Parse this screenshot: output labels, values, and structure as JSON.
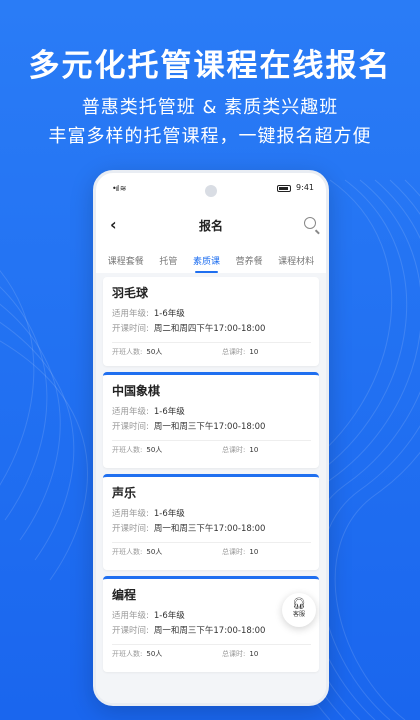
{
  "headline": "多元化托管课程在线报名",
  "subline1": "普惠类托管班 & 素质类兴趣班",
  "subline2": "丰富多样的托管课程，一键报名超方便",
  "status": {
    "time": "9:41",
    "signal": "•ıl ≋"
  },
  "nav": {
    "back": "‹",
    "title": "报名"
  },
  "tabs": [
    {
      "label": "课程套餐",
      "active": false
    },
    {
      "label": "托管",
      "active": false
    },
    {
      "label": "素质课",
      "active": true
    },
    {
      "label": "营养餐",
      "active": false
    },
    {
      "label": "课程材料",
      "active": false
    }
  ],
  "cards": [
    {
      "name": "羽毛球",
      "grade_label": "适用年级:",
      "grade": "1-6年级",
      "time_label": "开课时间:",
      "time": "周二和周四下午17:00-18:00",
      "people_label": "开班人数:",
      "people": "50人",
      "hours_label": "总课时:",
      "hours": "10"
    },
    {
      "name": "中国象棋",
      "grade_label": "适用年级:",
      "grade": "1-6年级",
      "time_label": "开课时间:",
      "time": "周一和周三下午17:00-18:00",
      "people_label": "开班人数:",
      "people": "50人",
      "hours_label": "总课时:",
      "hours": "10"
    },
    {
      "name": "声乐",
      "grade_label": "适用年级:",
      "grade": "1-6年级",
      "time_label": "开课时间:",
      "time": "周一和周三下午17:00-18:00",
      "people_label": "开班人数:",
      "people": "50人",
      "hours_label": "总课时:",
      "hours": "10"
    },
    {
      "name": "编程",
      "grade_label": "适用年级:",
      "grade": "1-6年级",
      "time_label": "开课时间:",
      "time": "周一和周三下午17:00-18:00",
      "people_label": "开班人数:",
      "people": "50人",
      "hours_label": "总课时:",
      "hours": "10"
    }
  ],
  "service": {
    "icon": "headset-icon",
    "label": "客服"
  },
  "colors": {
    "primary": "#1f6ff0",
    "background": "#1d6ff2"
  }
}
